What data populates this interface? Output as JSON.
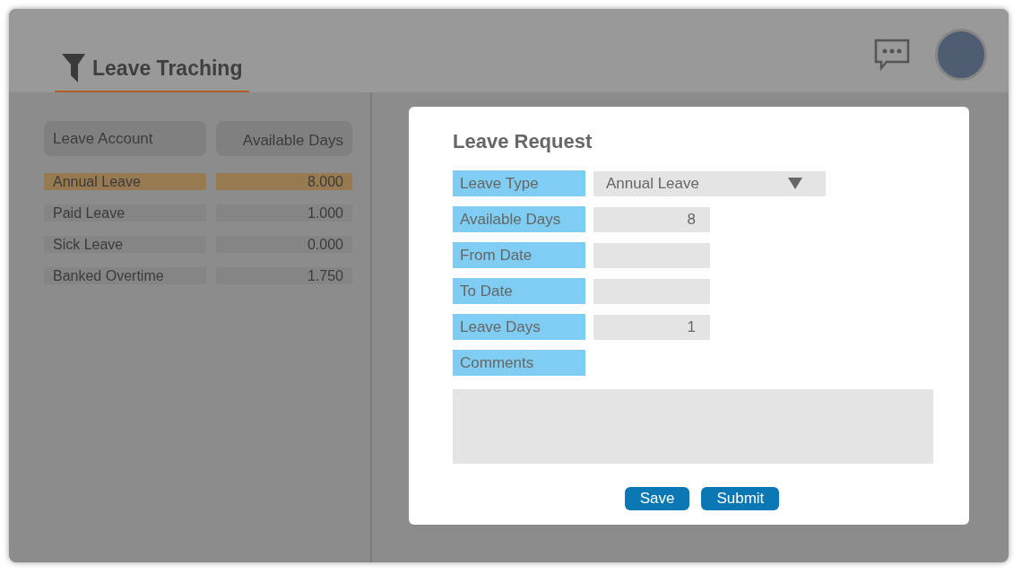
{
  "header": {
    "tab": {
      "label": "Leave Traching",
      "selected": true
    }
  },
  "accounts": {
    "columns": [
      "Leave Account",
      "Available Days"
    ],
    "rows": [
      {
        "name": "Annual Leave",
        "days": "8.000",
        "selected": true
      },
      {
        "name": "Paid Leave",
        "days": "1.000",
        "selected": false
      },
      {
        "name": "Sick Leave",
        "days": "0.000",
        "selected": false
      },
      {
        "name": "Banked Overtime",
        "days": "1.750",
        "selected": false
      }
    ]
  },
  "dialog": {
    "title": "Leave Request",
    "fields": [
      {
        "label": "Leave Type",
        "kind": "select",
        "value": "Annual Leave"
      },
      {
        "label": "Available Days",
        "kind": "number",
        "value": "8"
      },
      {
        "label": "From Date",
        "kind": "date"
      },
      {
        "label": "To Date",
        "kind": "date"
      },
      {
        "label": "Leave Days",
        "kind": "number",
        "value": "1"
      },
      {
        "label": "Comments",
        "kind": "textarea"
      }
    ],
    "buttons": [
      "Save",
      "Submit"
    ]
  }
}
